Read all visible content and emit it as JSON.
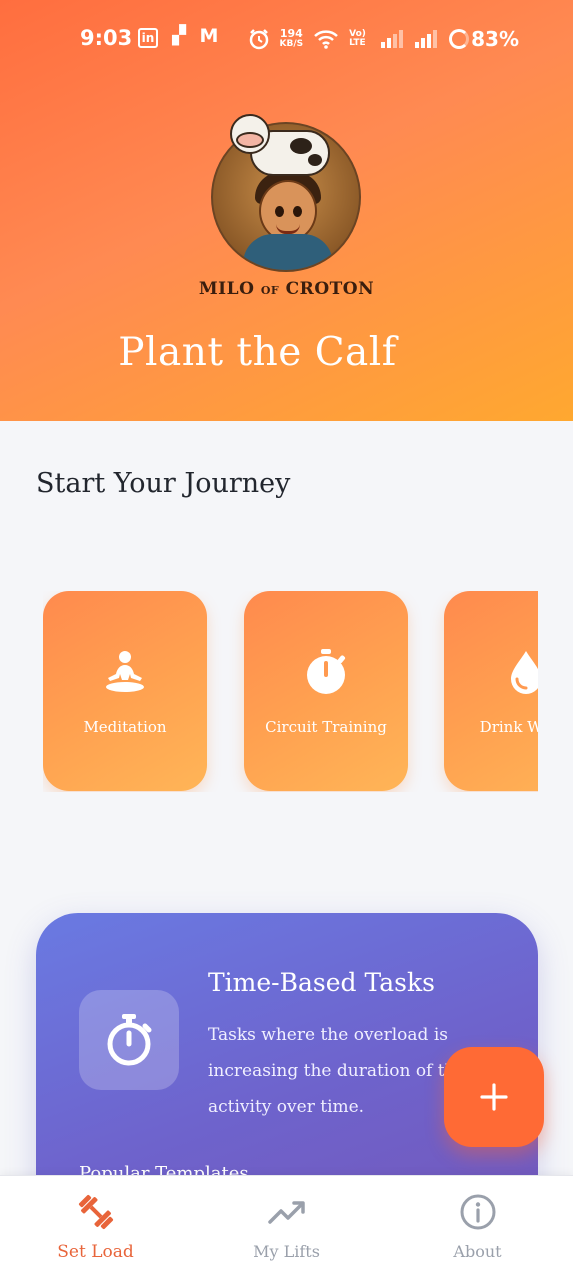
{
  "status_bar": {
    "time": "9:03",
    "app_icons": [
      "in",
      "▞",
      "M"
    ],
    "network_speed_value": "194",
    "network_speed_unit": "KB/S",
    "network_type": "Vo) LTE",
    "battery_percent": "83%"
  },
  "header": {
    "logo_text_main": "MILO",
    "logo_text_of": "OF",
    "logo_text_brand": "CROTON",
    "title": "Plant the Calf"
  },
  "journey": {
    "title": "Start Your Journey",
    "categories": [
      {
        "label": "Meditation",
        "icon": "meditation-icon"
      },
      {
        "label": "Circuit Training",
        "icon": "stopwatch-icon"
      },
      {
        "label": "Drink Water",
        "icon": "water-drop-icon"
      }
    ]
  },
  "task_card": {
    "title": "Time-Based Tasks",
    "description": "Tasks where the overload is increasing the duration of the activity over time.",
    "subheading": "Popular Templates",
    "icon": "stopwatch-icon"
  },
  "fab": {
    "label": "+",
    "icon": "plus-icon"
  },
  "bottom_nav": {
    "items": [
      {
        "label": "Set Load",
        "icon": "dumbbell-icon",
        "active": true
      },
      {
        "label": "My Lifts",
        "icon": "trending-up-icon",
        "active": false
      },
      {
        "label": "About",
        "icon": "info-icon",
        "active": false
      }
    ]
  },
  "colors": {
    "accent": "#ff6a35",
    "header_gradient_start": "#ff6e3f",
    "header_gradient_end": "#ffa830",
    "card_gradient_start": "#6a7ae2",
    "card_gradient_end": "#7458bb",
    "nav_active": "#e8643a",
    "nav_inactive": "#9aa0ab"
  }
}
